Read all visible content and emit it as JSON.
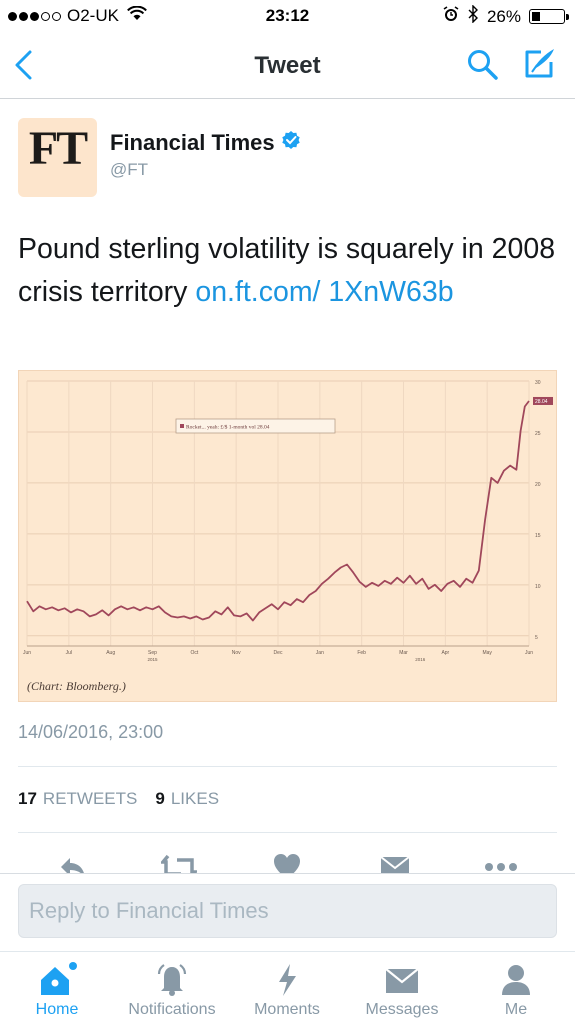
{
  "status_bar": {
    "carrier": "O2-UK",
    "time": "23:12",
    "battery": "26%",
    "battery_level": 0.26
  },
  "nav": {
    "title": "Tweet"
  },
  "author": {
    "logo_text": "FT",
    "name": "Financial Times",
    "handle": "@FT"
  },
  "tweet": {
    "text": "Pound sterling volatility is squarely in 2008 crisis territory ",
    "link": "on.ft.com/ 1XnW63b",
    "timestamp": "14/06/2016, 23:00"
  },
  "chart": {
    "caption": "(Chart: Bloomberg.)"
  },
  "chart_data": {
    "type": "line",
    "legend": "Rocket... yeah: £/$ 1-month vol 28.04",
    "last_value_label": "28.04",
    "x_ticks": [
      "Jun",
      "Jul",
      "Aug",
      "Sep",
      "Oct",
      "Nov",
      "Dec",
      "Jan",
      "Feb",
      "Mar",
      "Apr",
      "May",
      "Jun"
    ],
    "x_year_labels": [
      "2015",
      "2016"
    ],
    "y_ticks": [
      5,
      10,
      15,
      20,
      25,
      30
    ],
    "ylim": [
      4,
      30
    ],
    "grid": true,
    "series": [
      {
        "x": [
          0,
          0.15,
          0.3,
          0.45,
          0.6,
          0.75,
          0.9,
          1.05,
          1.2,
          1.35,
          1.5,
          1.65,
          1.8,
          1.95,
          2.1,
          2.25,
          2.4,
          2.55,
          2.7,
          2.85,
          3.0,
          3.15,
          3.3,
          3.45,
          3.6,
          3.75,
          3.9,
          4.05,
          4.2,
          4.35,
          4.5,
          4.65,
          4.8,
          4.95,
          5.1,
          5.25,
          5.4,
          5.55,
          5.7,
          5.85,
          6.0,
          6.15,
          6.3,
          6.45,
          6.6,
          6.75,
          6.9,
          7.05,
          7.2,
          7.35,
          7.5,
          7.65,
          7.8,
          7.95,
          8.1,
          8.25,
          8.4,
          8.55,
          8.7,
          8.85,
          9.0,
          9.15,
          9.3,
          9.45,
          9.6,
          9.75,
          9.9,
          10.05,
          10.2,
          10.35,
          10.5,
          10.65,
          10.8,
          10.95,
          11.1,
          11.25,
          11.4,
          11.55,
          11.7,
          11.8,
          11.9,
          12.0
        ],
        "y": [
          8.4,
          7.4,
          7.9,
          7.6,
          7.8,
          7.5,
          7.7,
          7.3,
          7.6,
          7.4,
          6.9,
          7.1,
          7.5,
          7.0,
          7.6,
          7.9,
          7.6,
          7.8,
          7.5,
          7.8,
          7.6,
          7.9,
          7.3,
          6.9,
          6.8,
          6.9,
          6.7,
          6.9,
          6.6,
          6.8,
          7.4,
          7.1,
          7.8,
          7.0,
          6.9,
          7.2,
          6.5,
          7.3,
          7.7,
          8.1,
          7.6,
          8.3,
          8.0,
          8.6,
          8.3,
          9.0,
          9.4,
          10.1,
          10.6,
          11.2,
          11.7,
          12.0,
          11.2,
          10.3,
          9.8,
          10.2,
          9.9,
          10.4,
          10.1,
          10.7,
          10.2,
          10.9,
          10.1,
          10.6,
          9.6,
          10.0,
          9.4,
          10.1,
          10.4,
          9.8,
          10.6,
          10.2,
          11.4,
          16.4,
          20.5,
          20.0,
          21.2,
          21.7,
          21.3,
          25.1,
          27.5,
          28.04
        ]
      }
    ]
  },
  "stats": {
    "retweets_count": "17",
    "retweets_label": "RETWEETS",
    "likes_count": "9",
    "likes_label": "LIKES"
  },
  "reply": {
    "placeholder": "Reply to Financial Times"
  },
  "tabs": [
    {
      "label": "Home",
      "icon": "home-icon",
      "active": true
    },
    {
      "label": "Notifications",
      "icon": "bell-icon",
      "active": false
    },
    {
      "label": "Moments",
      "icon": "lightning-icon",
      "active": false
    },
    {
      "label": "Messages",
      "icon": "envelope-icon",
      "active": false
    },
    {
      "label": "Me",
      "icon": "person-icon",
      "active": false
    }
  ],
  "colors": {
    "accent": "#1da1f2",
    "line": "#a0475b",
    "chart_bg": "#fde8d0"
  }
}
